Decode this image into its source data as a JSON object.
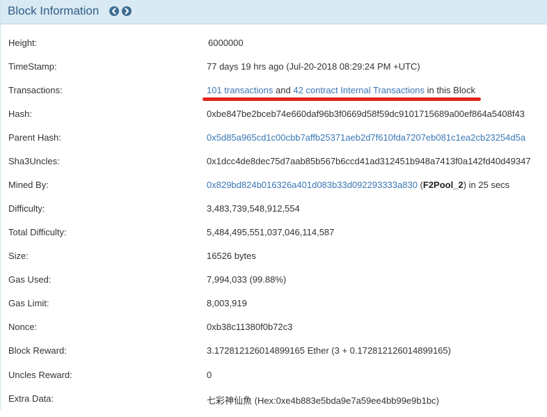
{
  "header": {
    "title": "Block Information",
    "prev_icon": "chevron-left-icon",
    "next_icon": "chevron-right-icon",
    "accent_color": "#3d6d93"
  },
  "rows": {
    "height": {
      "label": "Height:",
      "value": "6000000"
    },
    "timestamp": {
      "label": "TimeStamp:",
      "value": "77 days 19 hrs ago (Jul-20-2018 08:29:24 PM +UTC)"
    },
    "transactions": {
      "label": "Transactions:",
      "tx_link": "101 transactions",
      "and_text": "and",
      "internal_link": "42 contract Internal Transactions",
      "suffix": "in this Block"
    },
    "hash": {
      "label": "Hash:",
      "value": "0xbe847be2bceb74e660daf96b3f0669d58f59dc9101715689a00ef864a5408f43"
    },
    "parent_hash": {
      "label": "Parent Hash:",
      "value": "0x5d85a965cd1c00cbb7affb25371aeb2d7f610fda7207eb081c1ea2cb23254d5a"
    },
    "sha3uncles": {
      "label": "Sha3Uncles:",
      "value": "0x1dcc4de8dec75d7aab85b567b6ccd41ad312451b948a7413f0a142fd40d49347"
    },
    "mined_by": {
      "label": "Mined By:",
      "address": "0x829bd824b016326a401d083b33d092293333a830",
      "pool": "F2Pool_2",
      "suffix": "in 25 secs"
    },
    "difficulty": {
      "label": "Difficulty:",
      "value": "3,483,739,548,912,554"
    },
    "total_difficulty": {
      "label": "Total Difficulty:",
      "value": "5,484,495,551,037,046,114,587"
    },
    "size": {
      "label": "Size:",
      "value": "16526 bytes"
    },
    "gas_used": {
      "label": "Gas Used:",
      "value": "7,994,033 (99.88%)"
    },
    "gas_limit": {
      "label": "Gas Limit:",
      "value": "8,003,919"
    },
    "nonce": {
      "label": "Nonce:",
      "value": "0xb38c11380f0b72c3"
    },
    "block_reward": {
      "label": "Block Reward:",
      "value": "3.172812126014899165 Ether (3 + 0.172812126014899165)"
    },
    "uncles_reward": {
      "label": "Uncles Reward:",
      "value": "0"
    },
    "extra_data": {
      "label": "Extra Data:",
      "value": "七彩神仙魚 (Hex:0xe4b883e5bda9e7a59ee4bb99e9b1bc)"
    }
  },
  "annotation": {
    "underline_color": "#e2231a"
  }
}
